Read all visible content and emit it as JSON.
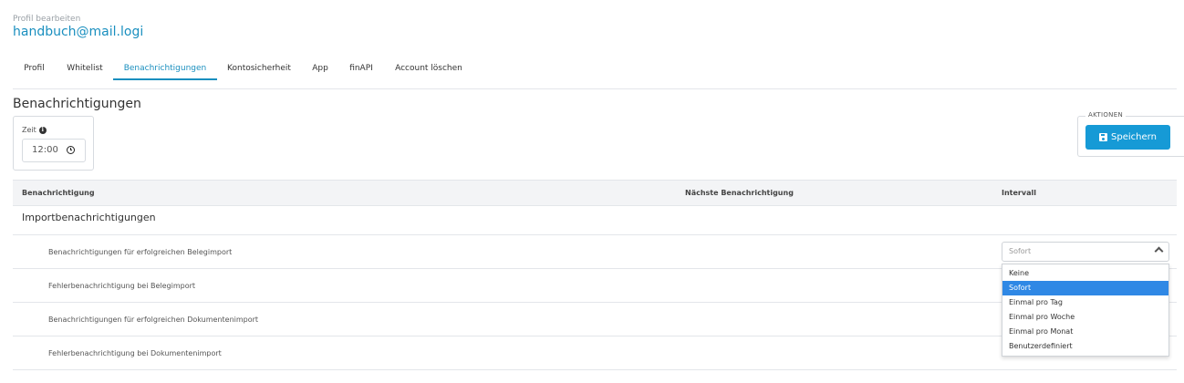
{
  "profile": {
    "caption": "Profil bearbeiten",
    "email": "handbuch@mail.logi"
  },
  "tabs": [
    {
      "label": "Profil"
    },
    {
      "label": "Whitelist"
    },
    {
      "label": "Benachrichtigungen",
      "active": true
    },
    {
      "label": "Kontosicherheit"
    },
    {
      "label": "App"
    },
    {
      "label": "finAPI"
    },
    {
      "label": "Account löschen"
    }
  ],
  "section": {
    "title": "Benachrichtigungen"
  },
  "time": {
    "label": "Zeit",
    "value": "12:00"
  },
  "actions": {
    "legend": "AKTIONEN",
    "save_label": "Speichern"
  },
  "table": {
    "headers": [
      "Benachrichtigung",
      "Nächste Benachrichtigung",
      "Intervall"
    ],
    "group": "Importbenachrichtigungen",
    "rows": [
      "Benachrichtigungen für erfolgreichen Belegimport",
      "Fehlerbenachrichtigung bei Belegimport",
      "Benachrichtigungen für erfolgreichen Dokumentenimport",
      "Fehlerbenachrichtigung bei Dokumentenimport"
    ]
  },
  "interval_select": {
    "value": "Sofort",
    "options": [
      "Keine",
      "Sofort",
      "Einmal pro Tag",
      "Einmal pro Woche",
      "Einmal pro Monat",
      "Benutzerdefiniert"
    ],
    "selected_index": 1
  },
  "colors": {
    "accent": "#1a8fbf",
    "button": "#169ad6",
    "selected_option": "#2f88e5"
  },
  "icons": {
    "info": "info-icon",
    "clock": "clock-icon",
    "save": "floppy-icon",
    "chevron": "chevron-up-icon"
  }
}
